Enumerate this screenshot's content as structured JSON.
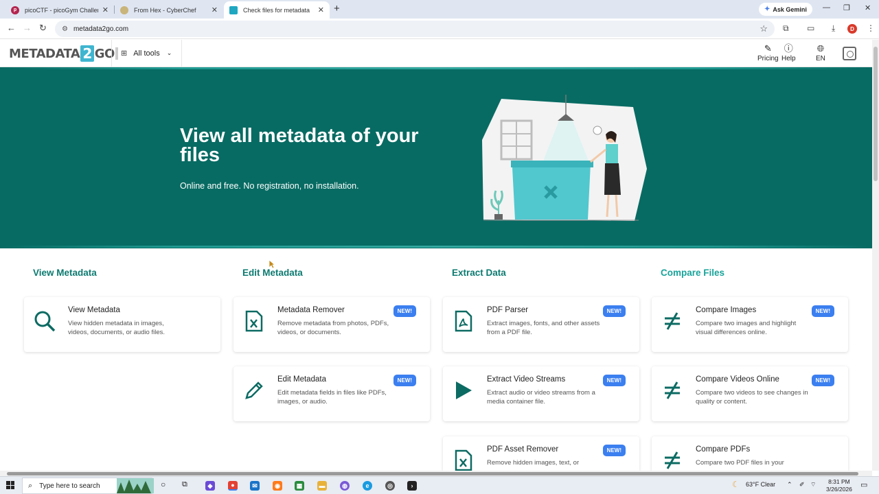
{
  "browser": {
    "tabs": [
      {
        "title": "picoCTF - picoGym Challenges",
        "favicon": "picoctf-icon",
        "active": false
      },
      {
        "title": "From Hex - CyberChef",
        "favicon": "cyberchef-icon",
        "active": false
      },
      {
        "title": "Check files for metadata",
        "favicon": "metadata2go-icon",
        "active": true
      }
    ],
    "new_tab": "+",
    "gemini_label": "Ask Gemini",
    "url": "metadata2go.com",
    "profile_initial": "D"
  },
  "site": {
    "logo_left": "METADATA",
    "logo_num": "2",
    "logo_right": "GO",
    "all_tools": "All tools",
    "pricing": "Pricing",
    "help": "Help",
    "language": "EN"
  },
  "hero": {
    "title": "View all metadata of your files",
    "subtitle": "Online and free. No registration, no installation."
  },
  "columns": [
    {
      "heading": "View Metadata"
    },
    {
      "heading": "Edit Metadata"
    },
    {
      "heading": "Extract Data"
    },
    {
      "heading": "Compare Files"
    }
  ],
  "cards": [
    {
      "title": "View Metadata",
      "desc": "View hidden metadata in images, videos, documents, or audio files.",
      "icon": "magnifier-icon",
      "badge": ""
    },
    {
      "title": "Metadata Remover",
      "desc": "Remove metadata from photos, PDFs, videos, or documents.",
      "icon": "file-x-icon",
      "badge": "NEW!"
    },
    {
      "title": "Edit Metadata",
      "desc": "Edit metadata fields in files like PDFs, images, or audio.",
      "icon": "pencil-icon",
      "badge": "NEW!"
    },
    {
      "title": "PDF Parser",
      "desc": "Extract images, fonts, and other assets from a PDF file.",
      "icon": "pdf-icon",
      "badge": "NEW!"
    },
    {
      "title": "Extract Video Streams",
      "desc": "Extract audio or video streams from a media container file.",
      "icon": "play-icon",
      "badge": "NEW!"
    },
    {
      "title": "PDF Asset Remover",
      "desc": "Remove hidden images, text, or",
      "icon": "file-x-icon",
      "badge": "NEW!"
    },
    {
      "title": "Compare Images",
      "desc": "Compare two images and highlight visual differences online.",
      "icon": "not-equal-icon",
      "badge": "NEW!"
    },
    {
      "title": "Compare Videos Online",
      "desc": "Compare two videos to see changes in quality or content.",
      "icon": "not-equal-icon",
      "badge": "NEW!"
    },
    {
      "title": "Compare PDFs",
      "desc": "Compare two PDF files in your",
      "icon": "not-equal-icon",
      "badge": ""
    }
  ],
  "taskbar": {
    "search_placeholder": "Type here to search",
    "weather": "63°F  Clear",
    "time": "8:31 PM",
    "date": "3/26/2026"
  }
}
